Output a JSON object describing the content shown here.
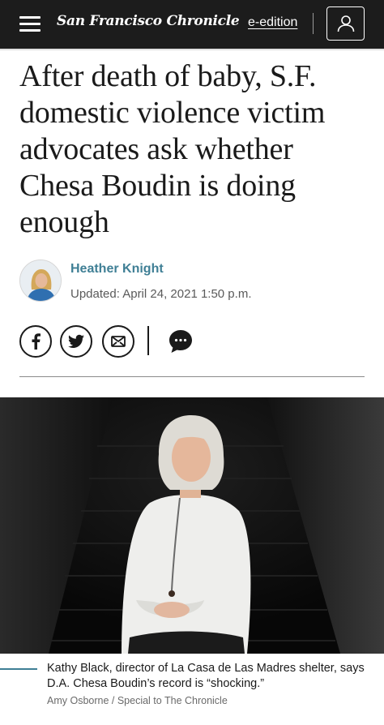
{
  "header": {
    "masthead": "San Francisco Chronicle",
    "eedition_label": "e-edition"
  },
  "article": {
    "headline": "After death of baby, S.F. domestic violence victim advocates ask whether Chesa Boudin is doing enough",
    "author": "Heather Knight",
    "updated": "Updated: April 24, 2021 1:50 p.m."
  },
  "photo": {
    "caption": "Kathy Black, director of La Casa de Las Madres shelter, says D.A. Chesa Boudin’s record is “shocking.”",
    "credit": "Amy Osborne / Special to The Chronicle"
  },
  "colors": {
    "header_bg": "#1c1c1c",
    "accent": "#3f7f95"
  },
  "icons": [
    "menu-icon",
    "user-icon",
    "facebook-icon",
    "twitter-icon",
    "mail-icon",
    "comment-icon"
  ]
}
